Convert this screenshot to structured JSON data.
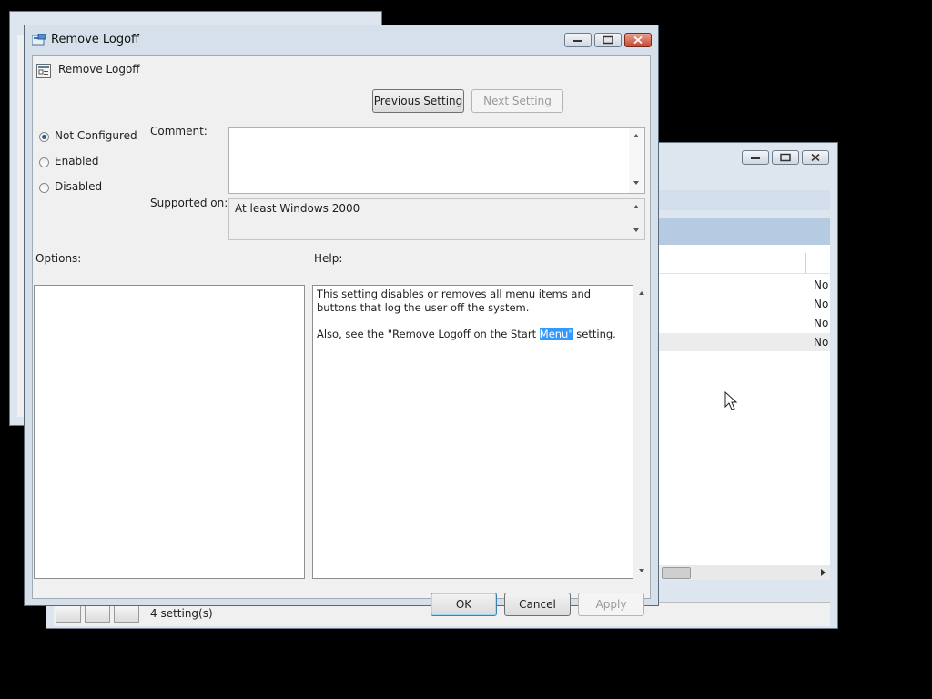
{
  "dialog": {
    "title": "Remove Logoff",
    "setting_name": "Remove Logoff",
    "previous_label": "Previous Setting",
    "next_label": "Next Setting",
    "radio_not_configured": "Not Configured",
    "radio_enabled": "Enabled",
    "radio_disabled": "Disabled",
    "selected_option": "Not Configured",
    "comment_label": "Comment:",
    "comment_value": "",
    "supported_label": "Supported on:",
    "supported_value": "At least Windows 2000",
    "options_label": "Options:",
    "help_label": "Help:",
    "help_line1": "This setting disables or removes all menu items and buttons that log the user off the system.",
    "help_line2_before": "Also, see the \"Remove Logoff on the Start ",
    "help_line2_selected": "Menu\"",
    "help_line2_after": " setting.",
    "ok_label": "OK",
    "cancel_label": "Cancel",
    "apply_label": "Apply"
  },
  "background_window": {
    "row_values": [
      "No",
      "No",
      "No",
      "No"
    ],
    "status_text": "4 setting(s)"
  },
  "colors": {
    "desktop": "#000000",
    "dialog_bg": "#f0f0f0",
    "frame": "#d6e0ea",
    "selection": "#3399ff"
  }
}
